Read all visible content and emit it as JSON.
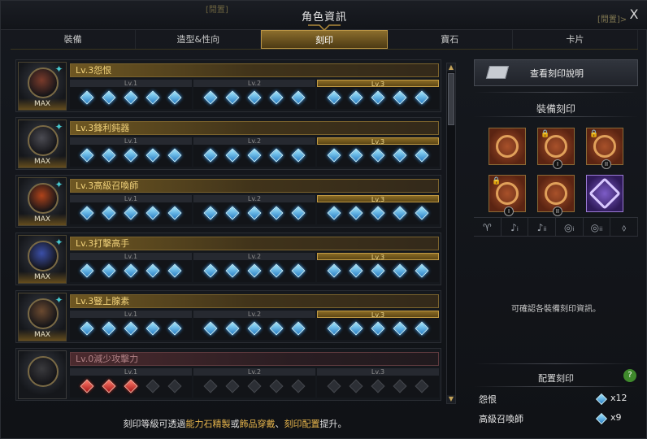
{
  "window": {
    "title": "角色資訊",
    "close_label": "X",
    "bg_hint_left": "[閒置]",
    "bg_hint_right": "[閒置]>"
  },
  "tabs": [
    "裝備",
    "造型&性向",
    "刻印",
    "寶石",
    "卡片"
  ],
  "active_tab": "刻印",
  "level_labels": [
    "Lv.1",
    "Lv.2",
    "Lv.3"
  ],
  "max_label": "MAX",
  "engravings": [
    {
      "name": "Lv.3怨恨",
      "level": 3,
      "max": true
    },
    {
      "name": "Lv.3鋒利鈍器",
      "level": 3,
      "max": true
    },
    {
      "name": "Lv.3高級召喚師",
      "level": 3,
      "max": true
    },
    {
      "name": "Lv.3打擊高手",
      "level": 3,
      "max": true
    },
    {
      "name": "Lv.3豎上腺素",
      "level": 3,
      "max": true
    },
    {
      "name": "Lv.0減少攻擊力",
      "level": 0,
      "max": false,
      "negative_nodes": 3
    }
  ],
  "footer": {
    "prefix": "刻印等級可透過",
    "hl1": "能力石精製",
    "mid1": "或",
    "hl2": "飾品穿戴",
    "mid2": "、",
    "hl3": "刻印配置",
    "suffix": "提升。"
  },
  "right_panel": {
    "help_button": "查看刻印說明",
    "equipped_title": "裝備刻印",
    "equipped_slots": [
      {
        "locked": false,
        "roman": "",
        "style": "orange"
      },
      {
        "locked": true,
        "roman": "I",
        "style": "orange"
      },
      {
        "locked": true,
        "roman": "II",
        "style": "orange"
      },
      {
        "locked": true,
        "roman": "I",
        "style": "orange"
      },
      {
        "locked": false,
        "roman": "II",
        "style": "orange"
      },
      {
        "locked": false,
        "roman": "",
        "style": "purple"
      }
    ],
    "slot_icon_names": [
      "necklace-icon",
      "earring-1-icon",
      "earring-2-icon",
      "ring-1-icon",
      "ring-2-icon",
      "stone-icon"
    ],
    "info_text": "可確認各裝備刻印資訊。",
    "config_title": "配置刻印",
    "help_q": "?",
    "config": [
      {
        "name": "怨恨",
        "count": "x12"
      },
      {
        "name": "高級召喚師",
        "count": "x9"
      }
    ]
  },
  "colors": {
    "accent": "#e8b64c",
    "gem_blue": "#2a7fc6",
    "gem_red": "#a91818"
  }
}
